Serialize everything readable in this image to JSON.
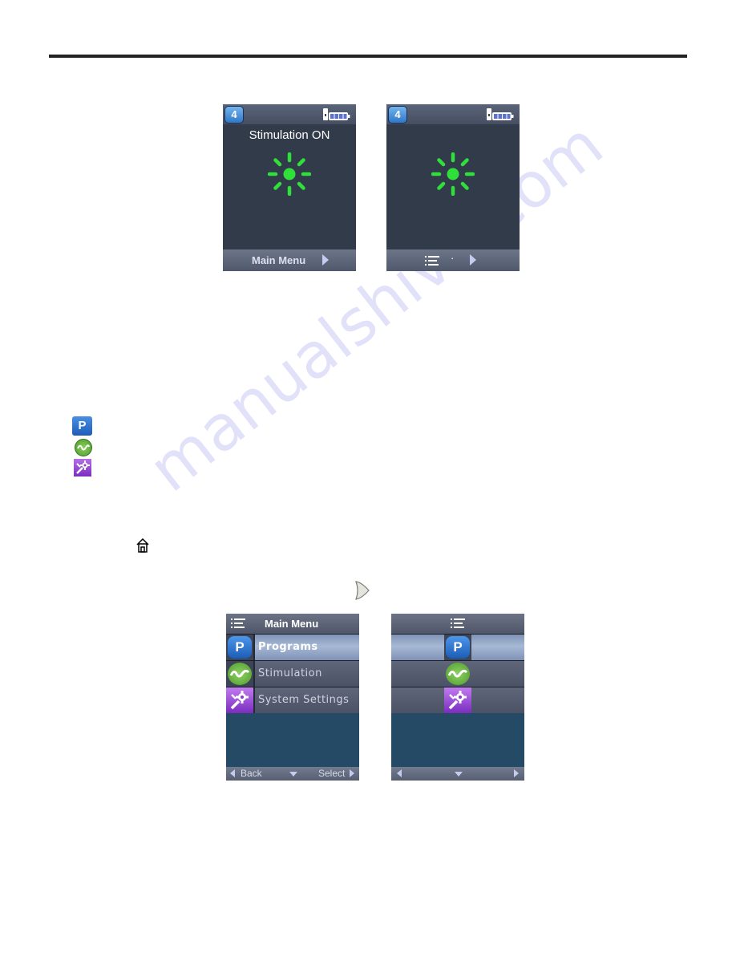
{
  "watermark": "manualshive.com",
  "screen_on": {
    "program_number": "4",
    "title": "Stimulation ON",
    "softkey_label": "Main Menu",
    "stim_color": "#2fe03a"
  },
  "screen_on_nolabel": {
    "program_number": "4",
    "separator": "·"
  },
  "legend_icons": [
    {
      "name": "programs-icon",
      "glyph": "P"
    },
    {
      "name": "stimulation-icon"
    },
    {
      "name": "system-settings-icon"
    }
  ],
  "main_menu": {
    "title": "Main Menu",
    "items": [
      {
        "label": "Programs",
        "glyph": "P",
        "selected": true
      },
      {
        "label": "Stimulation",
        "selected": false
      },
      {
        "label": "System Settings",
        "selected": false
      }
    ],
    "back_label": "Back",
    "select_label": "Select"
  },
  "icon_menu": {
    "items": [
      {
        "glyph": "P",
        "selected": true
      },
      {
        "selected": false
      },
      {
        "selected": false
      }
    ]
  }
}
